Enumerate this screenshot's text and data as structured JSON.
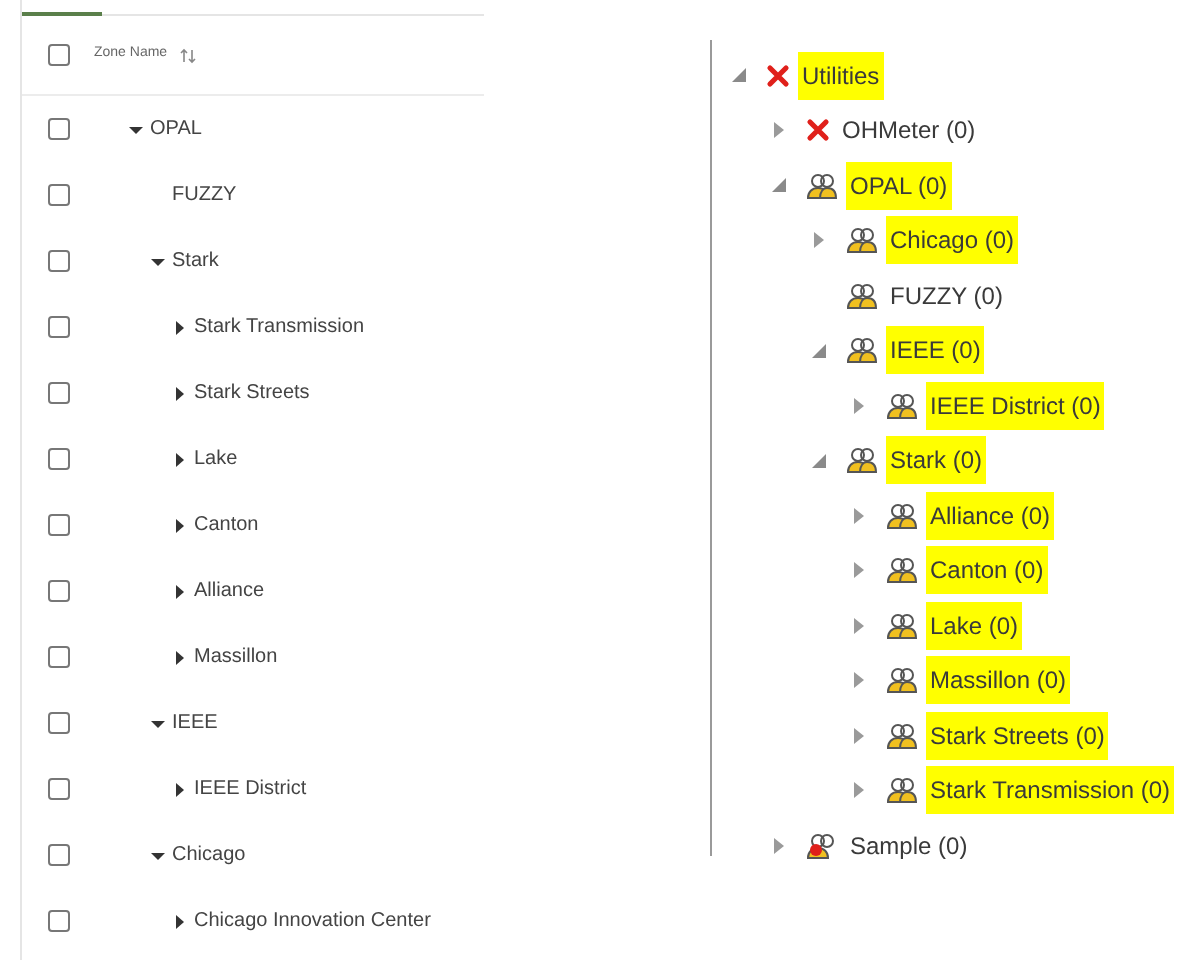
{
  "zone_table": {
    "header": {
      "label": "Zone Name",
      "checked": false
    },
    "rows": [
      {
        "label": "OPAL",
        "checked": false,
        "expandable": true,
        "expanded": true,
        "children": [
          {
            "label": "FUZZY",
            "checked": false,
            "expandable": false
          },
          {
            "label": "Stark",
            "checked": false,
            "expandable": true,
            "expanded": true,
            "children": [
              {
                "label": "Stark Transmission",
                "checked": false,
                "expandable": true,
                "expanded": false
              },
              {
                "label": "Stark Streets",
                "checked": false,
                "expandable": true,
                "expanded": false
              },
              {
                "label": "Lake",
                "checked": false,
                "expandable": true,
                "expanded": false
              },
              {
                "label": "Canton",
                "checked": false,
                "expandable": true,
                "expanded": false
              },
              {
                "label": "Alliance",
                "checked": false,
                "expandable": true,
                "expanded": false
              },
              {
                "label": "Massillon",
                "checked": false,
                "expandable": true,
                "expanded": false
              }
            ]
          },
          {
            "label": "IEEE",
            "checked": false,
            "expandable": true,
            "expanded": true,
            "children": [
              {
                "label": "IEEE District",
                "checked": false,
                "expandable": true,
                "expanded": false
              }
            ]
          },
          {
            "label": "Chicago",
            "checked": false,
            "expandable": true,
            "expanded": true,
            "children": [
              {
                "label": "Chicago Innovation Center",
                "checked": false,
                "expandable": true,
                "expanded": false
              }
            ]
          }
        ]
      }
    ]
  },
  "utility_tree": [
    {
      "label": "Utilities",
      "kind": "error",
      "highlighted": true,
      "expandable": true,
      "expanded": true,
      "children": [
        {
          "label": "OHMeter (0)",
          "kind": "error",
          "highlighted": false,
          "expandable": true,
          "expanded": false
        },
        {
          "label": "OPAL (0)",
          "kind": "group",
          "highlighted": true,
          "expandable": true,
          "expanded": true,
          "children": [
            {
              "label": "Chicago (0)",
              "kind": "group",
              "highlighted": true,
              "expandable": true,
              "expanded": false
            },
            {
              "label": "FUZZY (0)",
              "kind": "group",
              "highlighted": false,
              "expandable": false
            },
            {
              "label": "IEEE (0)",
              "kind": "group",
              "highlighted": true,
              "expandable": true,
              "expanded": true,
              "children": [
                {
                  "label": "IEEE District (0)",
                  "kind": "group",
                  "highlighted": true,
                  "expandable": true,
                  "expanded": false
                }
              ]
            },
            {
              "label": "Stark (0)",
              "kind": "group",
              "highlighted": true,
              "expandable": true,
              "expanded": true,
              "children": [
                {
                  "label": "Alliance (0)",
                  "kind": "group",
                  "highlighted": true,
                  "expandable": true,
                  "expanded": false
                },
                {
                  "label": "Canton (0)",
                  "kind": "group",
                  "highlighted": true,
                  "expandable": true,
                  "expanded": false
                },
                {
                  "label": "Lake (0)",
                  "kind": "group",
                  "highlighted": true,
                  "expandable": true,
                  "expanded": false
                },
                {
                  "label": "Massillon (0)",
                  "kind": "group",
                  "highlighted": true,
                  "expandable": true,
                  "expanded": false
                },
                {
                  "label": "Stark Streets (0)",
                  "kind": "group",
                  "highlighted": true,
                  "expandable": true,
                  "expanded": false
                },
                {
                  "label": "Stark Transmission (0)",
                  "kind": "group",
                  "highlighted": true,
                  "expandable": true,
                  "expanded": false
                }
              ]
            }
          ]
        },
        {
          "label": "Sample (0)",
          "kind": "group_alert",
          "highlighted": false,
          "expandable": true,
          "expanded": false
        }
      ]
    }
  ]
}
